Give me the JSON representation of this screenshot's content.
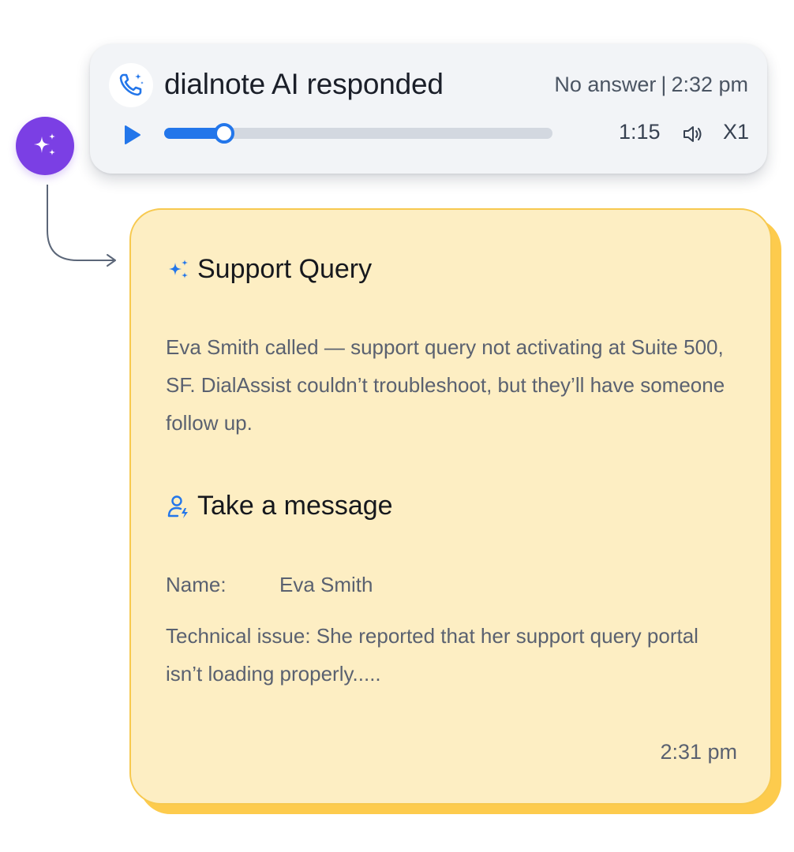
{
  "call": {
    "title": "dialnote AI responded",
    "status": "No answer",
    "separator": "|",
    "time": "2:32 pm",
    "duration": "1:15",
    "playback_speed": "X1",
    "progress_fraction": 0.155
  },
  "summary": {
    "heading": "Support Query",
    "text": "Eva Smith called — support query not activating at Suite 500, SF. DialAssist couldn’t troubleshoot, but they’ll have someone follow up."
  },
  "message": {
    "heading": "Take a message",
    "name_label": "Name:",
    "name_value": "Eva Smith",
    "issue_text": "Technical issue: She reported that her support query portal isn’t loading properly.....",
    "time": "2:31 pm"
  },
  "colors": {
    "ai_avatar": "#7b3fe4",
    "accent_blue": "#2376ea",
    "card_yellow": "#fdeec3",
    "card_yellow_shadow": "#fdcb4d"
  },
  "icons": {
    "avatar": "sparkles-icon",
    "call": "phone-sparkle-icon",
    "play": "play-icon",
    "volume": "volume-icon",
    "summary": "sparkles-icon",
    "message": "user-bolt-icon"
  }
}
